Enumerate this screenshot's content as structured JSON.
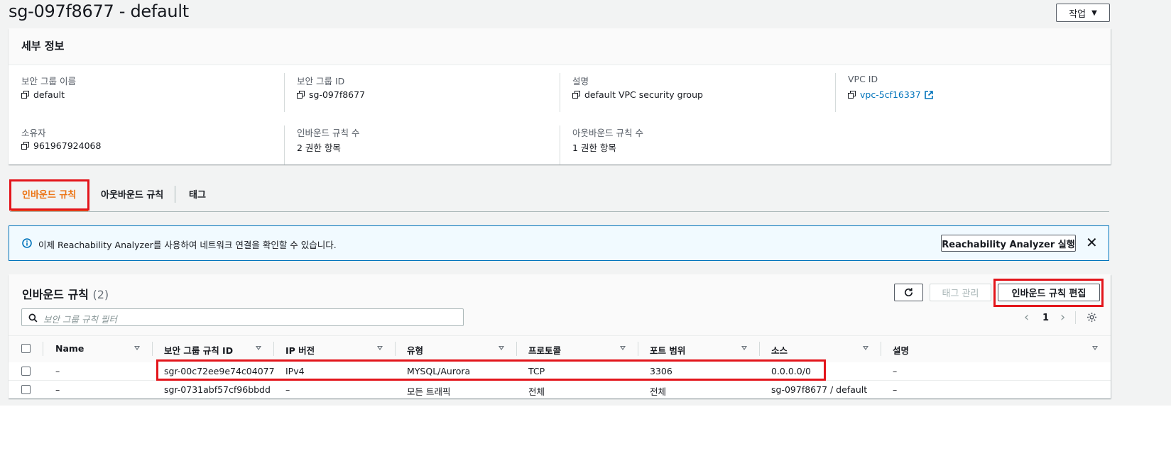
{
  "header": {
    "title": "sg-097f8677 - default",
    "actions_label": "작업"
  },
  "details": {
    "title": "세부 정보",
    "fields": [
      {
        "label": "보안 그룹 이름",
        "value": "default"
      },
      {
        "label": "보안 그룹 ID",
        "value": "sg-097f8677"
      },
      {
        "label": "설명",
        "value": "default VPC security group"
      },
      {
        "label": "VPC ID",
        "value": "vpc-5cf16337"
      },
      {
        "label": "소유자",
        "value": "961967924068"
      },
      {
        "label": "인바운드 규칙 수",
        "value": "2 권한 항목"
      },
      {
        "label": "아웃바운드 규칙 수",
        "value": "1 권한 항목"
      }
    ]
  },
  "tabs": [
    {
      "label": "인바운드 규칙",
      "active": true
    },
    {
      "label": "아웃바운드 규칙",
      "active": false
    },
    {
      "label": "태그",
      "active": false
    }
  ],
  "info_banner": {
    "text": "이제 Reachability Analyzer를 사용하여 네트워크 연결을 확인할 수 있습니다.",
    "button_label": "Reachability Analyzer 실행"
  },
  "rules": {
    "title": "인바운드 규칙",
    "count": "(2)",
    "manage_tags_label": "태그 관리",
    "edit_label": "인바운드 규칙 편집",
    "filter_placeholder": "보안 그룹 규칙 필터",
    "page": "1",
    "columns": [
      "Name",
      "보안 그룹 규칙 ID",
      "IP 버전",
      "유형",
      "프로토콜",
      "포트 범위",
      "소스",
      "설명"
    ],
    "rows": [
      [
        "–",
        "sgr-00c72ee9e74c04077",
        "IPv4",
        "MYSQL/Aurora",
        "TCP",
        "3306",
        "0.0.0.0/0",
        "–"
      ],
      [
        "–",
        "sgr-0731abf57cf96bbdd",
        "–",
        "모든 트래픽",
        "전체",
        "전체",
        "sg-097f8677 / default",
        "–"
      ]
    ]
  },
  "colors": {
    "accent": "#ec7211",
    "link": "#0073bb",
    "highlight": "#e3151b"
  }
}
